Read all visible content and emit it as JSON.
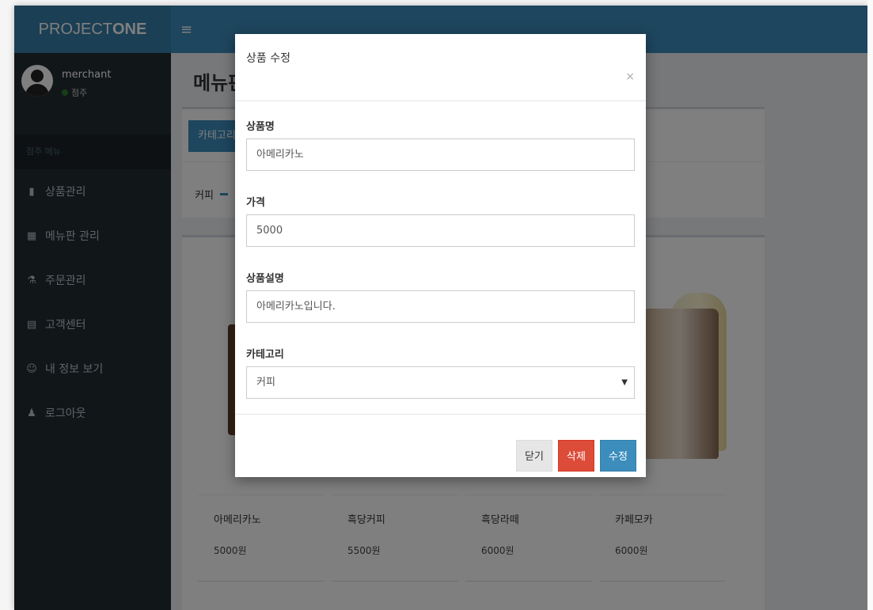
{
  "app": {
    "logo_prefix": "PROJECT",
    "logo_suffix": "ONE"
  },
  "user": {
    "name": "merchant",
    "role": "점주"
  },
  "sidebar": {
    "header": "점주 메뉴",
    "items": [
      {
        "label": "상품관리",
        "icon": "book-icon"
      },
      {
        "label": "메뉴판 관리",
        "icon": "calendar-icon"
      },
      {
        "label": "주문관리",
        "icon": "flask-icon"
      },
      {
        "label": "고객센터",
        "icon": "file-icon"
      },
      {
        "label": "내 정보 보기",
        "icon": "smile-icon"
      },
      {
        "label": "로그아웃",
        "icon": "user-icon"
      }
    ]
  },
  "header": {
    "menu_icon": "hamburger-icon"
  },
  "main": {
    "page_title": "메뉴판",
    "category_button": "카테고리",
    "category_row_label": "커피"
  },
  "products": [
    {
      "name": "아메리카노",
      "price": "5000원"
    },
    {
      "name": "흑당커피",
      "price": "5500원"
    },
    {
      "name": "흑당라떼",
      "price": "6000원"
    },
    {
      "name": "카페모카",
      "price": "6000원"
    }
  ],
  "modal": {
    "title": "상품 수정",
    "close_symbol": "×",
    "fields": {
      "name_label": "상품명",
      "name_value": "아메리카노",
      "price_label": "가격",
      "price_value": "5000",
      "desc_label": "상품설명",
      "desc_value": "아메리카노입니다.",
      "category_label": "카테고리",
      "category_value": "커피"
    },
    "buttons": {
      "close": "닫기",
      "delete": "삭제",
      "edit": "수정"
    }
  },
  "colors": {
    "sidebar_bg": "#222d32",
    "header_bg": "#3c8dbc",
    "logo_bg": "#367fa9",
    "danger": "#dd4b39",
    "primary": "#3c8dbc"
  }
}
